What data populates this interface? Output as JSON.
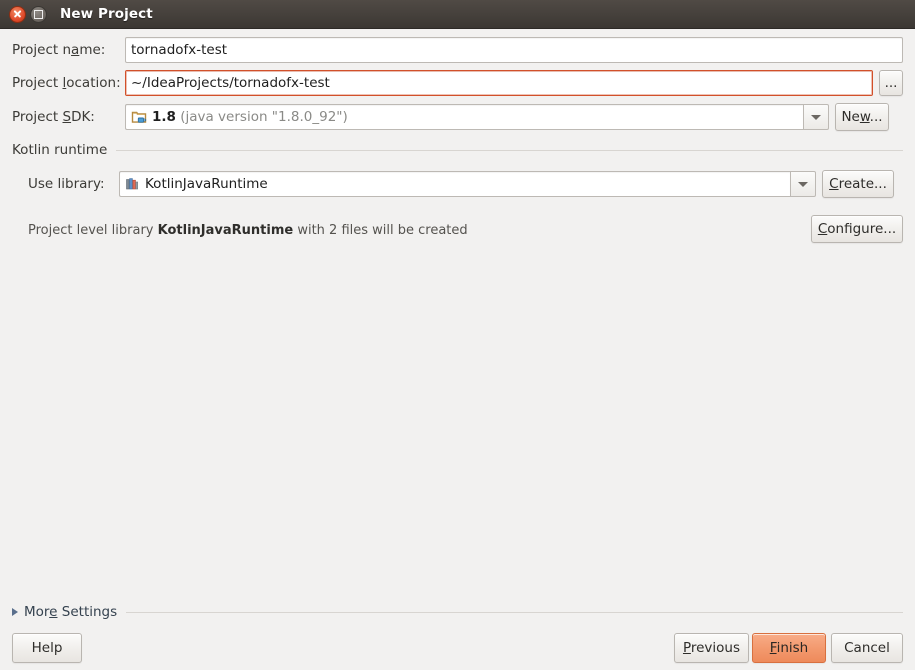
{
  "window": {
    "title": "New Project",
    "close_icon": "close-icon",
    "maximize_icon": "maximize-icon"
  },
  "form": {
    "project_name": {
      "label_pre": "Project n",
      "label_mn": "a",
      "label_post": "me:",
      "value": "tornadofx-test",
      "placeholder": ""
    },
    "project_location": {
      "label_pre": "Project ",
      "label_mn": "l",
      "label_post": "ocation:",
      "value": "~/IdeaProjects/tornadofx-test",
      "placeholder": "",
      "browse_label": "..."
    },
    "project_sdk": {
      "label_pre": "Project ",
      "label_mn": "S",
      "label_post": "DK:",
      "icon": "java-sdk-folder-icon",
      "version": "1.8",
      "detail": "(java version \"1.8.0_92\")",
      "new_button": {
        "pre": "Ne",
        "mn": "w",
        "post": "..."
      }
    }
  },
  "kotlin_runtime": {
    "group_title": "Kotlin runtime",
    "use_library": {
      "label": "Use library:",
      "icon": "library-books-icon",
      "value": "KotlinJavaRuntime"
    },
    "create_button": {
      "pre": "",
      "mn": "C",
      "post": "reate..."
    },
    "configure_button": {
      "pre": "",
      "mn": "C",
      "post": "onfigure..."
    },
    "description": {
      "pre": "Project level library ",
      "bold": "KotlinJavaRuntime",
      "post": " with 2 files will be created"
    }
  },
  "more_settings": {
    "pre": "Mor",
    "mn": "e",
    "post": " Settings",
    "expander_icon": "chevron-right-icon"
  },
  "footer": {
    "help": "Help",
    "previous": {
      "pre": "",
      "mn": "P",
      "post": "revious"
    },
    "finish": {
      "pre": "",
      "mn": "F",
      "post": "inish"
    },
    "cancel": "Cancel"
  },
  "colors": {
    "accent": "#ee8a5b",
    "focus_border": "#d2502a",
    "titlebar": "#46413c",
    "background": "#f2f1f0"
  }
}
